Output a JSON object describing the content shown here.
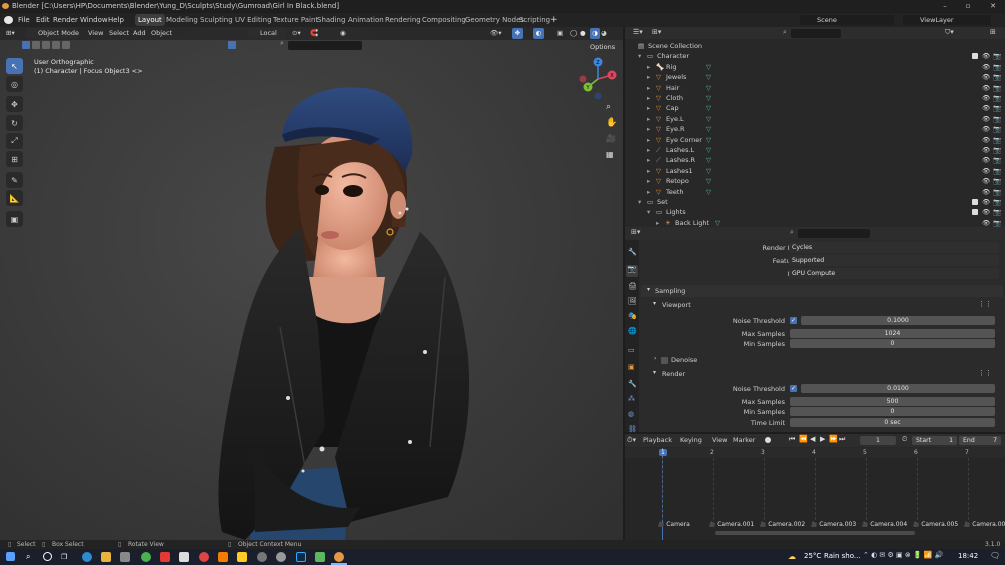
{
  "window": {
    "title": "Blender [C:\\Users\\HP\\Documents\\Blender\\Yung_D\\Sculpts\\Study\\Gumroad\\Girl In Black.blend]"
  },
  "menu": [
    "File",
    "Edit",
    "Render",
    "Window",
    "Help"
  ],
  "workspaces": [
    "Layout",
    "Modeling",
    "Sculpting",
    "UV Editing",
    "Texture Paint",
    "Shading",
    "Animation",
    "Rendering",
    "Compositing",
    "Geometry Nodes",
    "Scripting"
  ],
  "active_workspace": "Layout",
  "scene": {
    "name": "Scene",
    "view_layer": "ViewLayer"
  },
  "viewport": {
    "mode": "Object Mode",
    "menus": [
      "View",
      "Select",
      "Add",
      "Object"
    ],
    "transform_orientation": "Local",
    "options_label": "Options",
    "overlay_line1": "User Orthographic",
    "overlay_line2": "(1) Character | Focus Object3 <>",
    "gizmo_axes": {
      "x": "X",
      "y": "Y",
      "z": "Z"
    }
  },
  "outliner": {
    "root": "Scene Collection",
    "rows": [
      {
        "name": "Character",
        "indent": 1,
        "type": "collection",
        "checkbox": true
      },
      {
        "name": "Rig",
        "indent": 2,
        "type": "armature",
        "extra": "2"
      },
      {
        "name": "Jewels",
        "indent": 2,
        "type": "mesh",
        "extra": ""
      },
      {
        "name": "Hair",
        "indent": 2,
        "type": "mesh",
        "extra": ""
      },
      {
        "name": "Cloth",
        "indent": 2,
        "type": "mesh",
        "extra": ""
      },
      {
        "name": "Cap",
        "indent": 2,
        "type": "mesh",
        "extra": ""
      },
      {
        "name": "Eye.L",
        "indent": 2,
        "type": "mesh",
        "extra": ""
      },
      {
        "name": "Eye.R",
        "indent": 2,
        "type": "mesh",
        "extra": ""
      },
      {
        "name": "Eye Corner",
        "indent": 2,
        "type": "mesh",
        "extra": ""
      },
      {
        "name": "Lashes.L",
        "indent": 2,
        "type": "curve",
        "extra": ""
      },
      {
        "name": "Lashes.R",
        "indent": 2,
        "type": "curve",
        "extra": ""
      },
      {
        "name": "Lashes1",
        "indent": 2,
        "type": "mesh",
        "extra": ""
      },
      {
        "name": "Retopo",
        "indent": 2,
        "type": "mesh",
        "extra": ""
      },
      {
        "name": "Teeth",
        "indent": 2,
        "type": "mesh",
        "extra": ""
      },
      {
        "name": "Set",
        "indent": 1,
        "type": "collection",
        "checkbox": true
      },
      {
        "name": "Lights",
        "indent": 2,
        "type": "collection",
        "checkbox": true
      },
      {
        "name": "Back Light",
        "indent": 3,
        "type": "light",
        "extra": ""
      }
    ]
  },
  "properties": {
    "render_engine_label": "Render Engine",
    "render_engine": "Cycles",
    "feature_set_label": "Feature Set",
    "feature_set": "Supported",
    "device_label": "Device",
    "device": "GPU Compute",
    "sampling": "Sampling",
    "viewport_panel": "Viewport",
    "render_panel": "Render",
    "denoise": "Denoise",
    "vp_noise_threshold_label": "Noise Threshold",
    "vp_noise_threshold": "0.1000",
    "vp_max_samples_label": "Max Samples",
    "vp_max_samples": "1024",
    "vp_min_samples_label": "Min Samples",
    "vp_min_samples": "0",
    "r_noise_threshold_label": "Noise Threshold",
    "r_noise_threshold": "0.0100",
    "r_max_samples_label": "Max Samples",
    "r_max_samples": "500",
    "r_min_samples_label": "Min Samples",
    "r_min_samples": "0",
    "time_limit_label": "Time Limit",
    "time_limit": "0 sec"
  },
  "timeline": {
    "menus": [
      "Playback",
      "Keying",
      "View",
      "Marker"
    ],
    "current_frame": "1",
    "start_label": "Start",
    "start": "1",
    "end_label": "End",
    "end": "7",
    "frame_numbers": [
      "1",
      "2",
      "3",
      "4",
      "5",
      "6",
      "7"
    ],
    "markers": [
      "Camera",
      "Camera.001",
      "Camera.002",
      "Camera.003",
      "Camera.004",
      "Camera.005",
      "Camera.006"
    ]
  },
  "statusbar": {
    "select": "Select",
    "box_select": "Box Select",
    "rotate_view": "Rotate View",
    "context_menu": "Object Context Menu",
    "version": "3.1.0"
  },
  "taskbar": {
    "weather": "25°C",
    "weather_text": "Rain sho...",
    "clock": "18:42"
  },
  "colors": {
    "accent": "#4772b3",
    "orange": "#e49745",
    "green": "#5fbf97",
    "axis_x": "#e0455b",
    "axis_y": "#7fbd35",
    "axis_z": "#3d87e0"
  }
}
